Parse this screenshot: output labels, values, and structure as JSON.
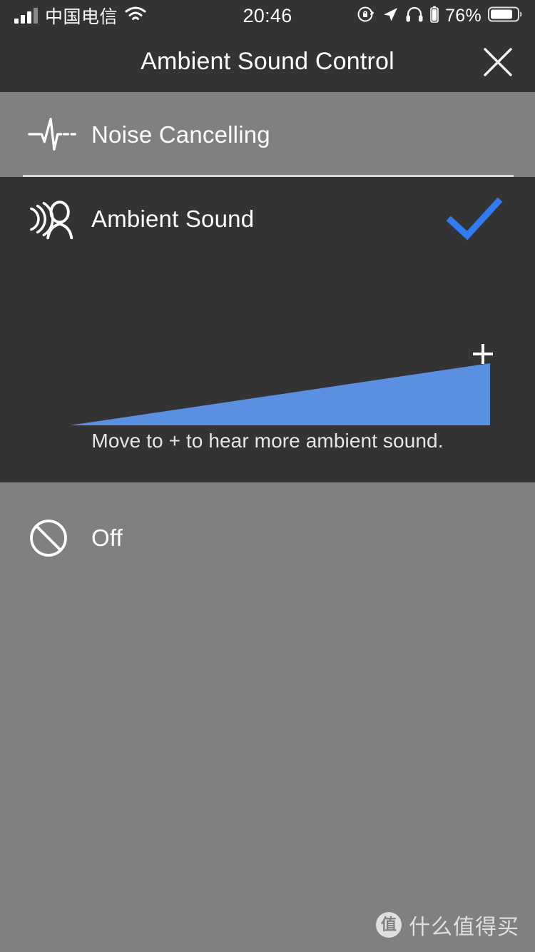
{
  "status_bar": {
    "carrier": "中国电信",
    "time": "20:46",
    "battery_percent": "76%",
    "signal_bars_filled": 3,
    "signal_bars_total": 4,
    "icons": [
      "signal-bars-icon",
      "wifi-icon",
      "rotation-lock-icon",
      "location-arrow-icon",
      "headphones-icon",
      "headphone-battery-icon",
      "battery-icon"
    ]
  },
  "nav": {
    "title": "Ambient Sound Control",
    "close_label": "close-icon"
  },
  "modes": {
    "noise_cancelling": {
      "label": "Noise Cancelling",
      "icon": "waveform-icon",
      "selected": false
    },
    "ambient_sound": {
      "label": "Ambient Sound",
      "icon": "ambient-person-icon",
      "selected": true,
      "check_icon": "check-icon",
      "slider": {
        "plus_label": "+",
        "value_percent": 100,
        "min": 0,
        "max": 20,
        "value": 20
      },
      "hint": "Move to + to hear more ambient sound."
    },
    "off": {
      "label": "Off",
      "icon": "prohibited-icon",
      "selected": false
    }
  },
  "watermark": {
    "logo_char": "值",
    "text": "什么值得买"
  },
  "colors": {
    "panel_dark": "#333333",
    "panel_gray": "#808080",
    "slider_blue": "#5b8fe0",
    "check_blue": "#2f7cf6",
    "text_white": "#ffffff"
  }
}
